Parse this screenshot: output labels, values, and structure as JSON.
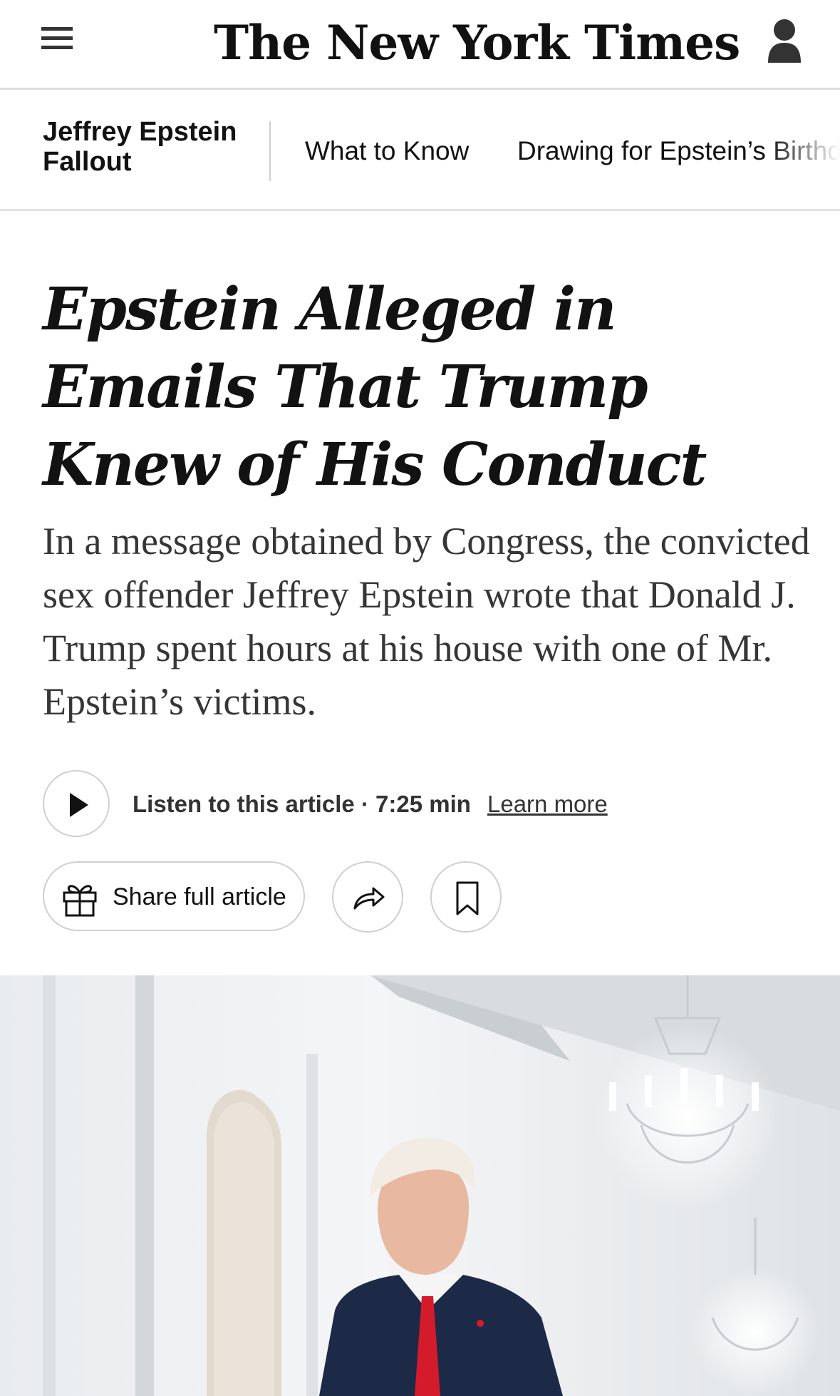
{
  "header": {
    "logo_text": "The New York Times",
    "menu_icon": "hamburger-menu-icon",
    "account_icon": "user-account-icon"
  },
  "section_nav": {
    "title": "Jeffrey Epstein Fallout",
    "links": [
      {
        "label": "What to Know"
      },
      {
        "label": "Drawing for Epstein’s Birthd"
      }
    ]
  },
  "article": {
    "headline": "Epstein Alleged in Emails That Trump Knew of His Conduct",
    "summary": "In a message obtained by Congress, the convicted sex offender Jeffrey Epstein wrote that Donald J. Trump spent hours at his house with one of Mr. Epstein’s victims.",
    "listen_label": "Listen to this article · 7:25 min",
    "learn_more": "Learn more",
    "share_full_label": "Share full article"
  },
  "colors": {
    "text": "#121212",
    "summary_text": "#363636",
    "border": "#cfcfcf",
    "tie_red": "#d41b2c",
    "suit_navy": "#1c2a48"
  },
  "icons": {
    "play": "play-icon",
    "gift": "gift-icon",
    "share": "share-arrow-icon",
    "bookmark": "bookmark-icon"
  }
}
